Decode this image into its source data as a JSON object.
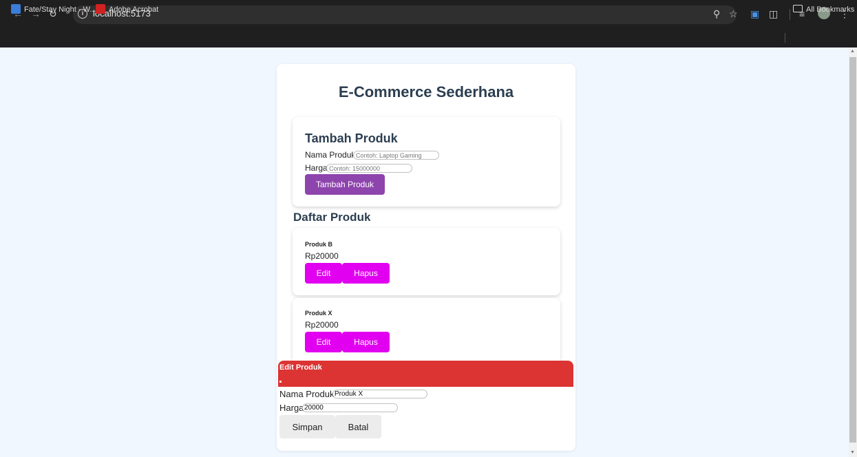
{
  "browser": {
    "url": "localhost:5173",
    "bookmarks": [
      {
        "label": "Fate/Stay Night - W..."
      },
      {
        "label": "Adobe Acrobat"
      }
    ],
    "all_bookmarks_label": "All Bookmarks"
  },
  "app": {
    "title": "E-Commerce Sederhana",
    "add_form": {
      "title": "Tambah Produk",
      "name_label": "Nama Produk",
      "name_placeholder": "Contoh: Laptop Gaming",
      "price_label": "Harga",
      "price_placeholder": "Contoh: 15000000",
      "submit_label": "Tambah Produk"
    },
    "list_title": "Daftar Produk",
    "products": [
      {
        "name": "Produk B",
        "price": "Rp20000",
        "edit_label": "Edit",
        "delete_label": "Hapus"
      },
      {
        "name": "Produk X",
        "price": "Rp20000",
        "edit_label": "Edit",
        "delete_label": "Hapus"
      }
    ],
    "edit_form": {
      "title": "Edit Produk",
      "name_label": "Nama Produk",
      "name_value": "Produk X",
      "price_label": "Harga",
      "price_value": "20000",
      "save_label": "Simpan",
      "cancel_label": "Batal"
    }
  },
  "colors": {
    "accent_purple": "#8e44ad",
    "button_magenta": "#e100f0",
    "edit_header_red": "#dc3333",
    "title_text": "#2c3e50",
    "page_background": "#f0f7ff"
  }
}
